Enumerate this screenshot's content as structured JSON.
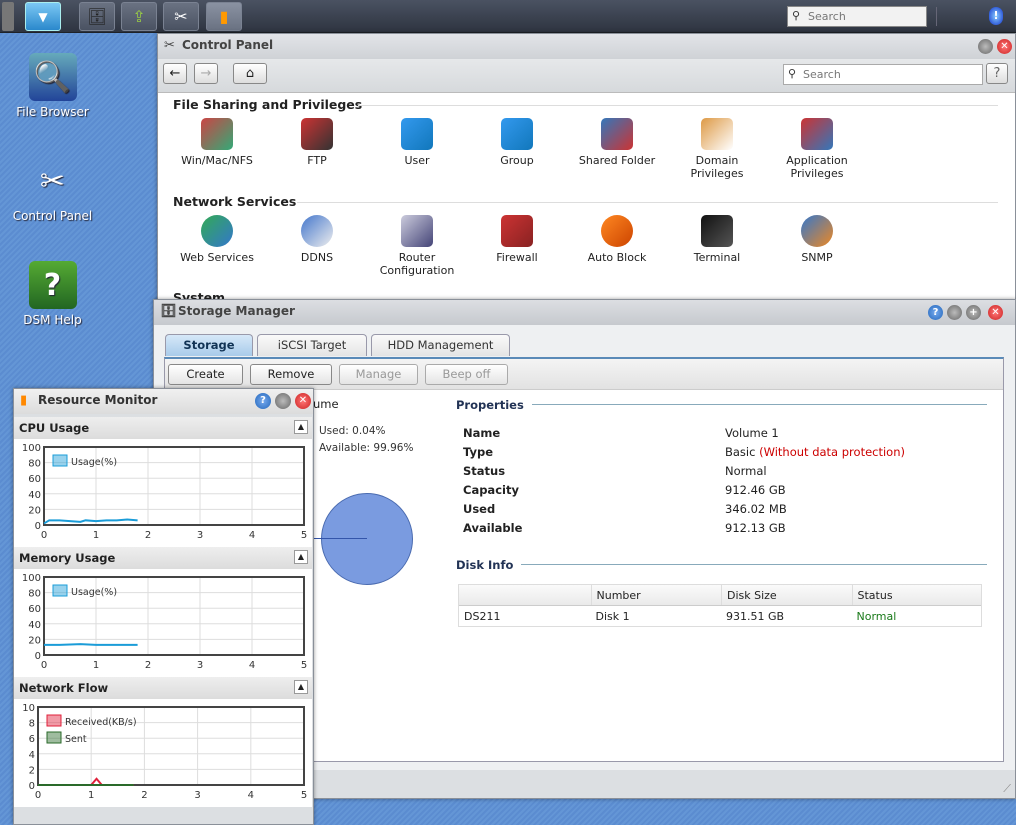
{
  "taskbar": {
    "search_placeholder": "Search",
    "apps": [
      "storage-manager",
      "download-station",
      "control-panel",
      "resource-monitor"
    ]
  },
  "desktop": {
    "icons": [
      {
        "label": "File Browser"
      },
      {
        "label": "Control Panel"
      },
      {
        "label": "DSM Help"
      }
    ]
  },
  "control_panel": {
    "title": "Control Panel",
    "search_placeholder": "Search",
    "help": "?",
    "sections": [
      {
        "title": "File Sharing and Privileges",
        "items": [
          "Win/Mac/NFS",
          "FTP",
          "User",
          "Group",
          "Shared Folder",
          "Domain Privileges",
          "Application Privileges"
        ]
      },
      {
        "title": "Network Services",
        "items": [
          "Web Services",
          "DDNS",
          "Router Configuration",
          "Firewall",
          "Auto Block",
          "Terminal",
          "SNMP"
        ]
      },
      {
        "title": "System",
        "items": []
      }
    ]
  },
  "storage_manager": {
    "title": "Storage Manager",
    "tabs": [
      "Storage",
      "iSCSI Target",
      "HDD Management"
    ],
    "active_tab": "Storage",
    "buttons": [
      {
        "label": "Create",
        "enabled": true
      },
      {
        "label": "Remove",
        "enabled": true
      },
      {
        "label": "Manage",
        "enabled": false
      },
      {
        "label": "Beep off",
        "enabled": false
      }
    ],
    "volume": {
      "label_partial": "ume",
      "used": "Used: 0.04%",
      "available": "Available: 99.96%",
      "used_pct": 0.04
    },
    "properties_title": "Properties",
    "properties": [
      {
        "k": "Name",
        "v": "Volume 1"
      },
      {
        "k": "Type",
        "v": "Basic",
        "note": "(Without data protection)"
      },
      {
        "k": "Status",
        "v": "Normal"
      },
      {
        "k": "Capacity",
        "v": "912.46 GB"
      },
      {
        "k": "Used",
        "v": "346.02 MB"
      },
      {
        "k": "Available",
        "v": "912.13 GB"
      }
    ],
    "disk_info_title": "Disk Info",
    "disk_columns": [
      "",
      "Number",
      "Disk Size",
      "Status"
    ],
    "disk_rows": [
      [
        "DS211",
        "Disk 1",
        "931.51 GB",
        "Normal"
      ]
    ],
    "colors": {
      "warning": "#cc0000",
      "ok": "#1a7a1a",
      "pie": "#7a9be0"
    }
  },
  "resource_monitor": {
    "title": "Resource Monitor",
    "sections": [
      "CPU Usage",
      "Memory Usage",
      "Network Flow"
    ]
  },
  "chart_data": [
    {
      "type": "line",
      "title": "CPU Usage",
      "xlim": [
        0,
        5
      ],
      "ylim": [
        0,
        100
      ],
      "xticks": [
        "0",
        "1",
        "2",
        "3",
        "4",
        "5"
      ],
      "yticks": [
        "0",
        "20",
        "40",
        "60",
        "80",
        "100"
      ],
      "grid": true,
      "legend": "top-left",
      "series": [
        {
          "name": "Usage(%)",
          "color": "#1a9cd8",
          "x": [
            0,
            0.1,
            0.3,
            0.5,
            0.7,
            0.8,
            1.0,
            1.2,
            1.4,
            1.6,
            1.8
          ],
          "y": [
            2,
            6,
            6,
            5,
            4,
            6,
            5,
            6,
            6,
            7,
            6
          ]
        }
      ]
    },
    {
      "type": "line",
      "title": "Memory Usage",
      "xlim": [
        0,
        5
      ],
      "ylim": [
        0,
        100
      ],
      "xticks": [
        "0",
        "1",
        "2",
        "3",
        "4",
        "5"
      ],
      "yticks": [
        "0",
        "20",
        "40",
        "60",
        "80",
        "100"
      ],
      "grid": true,
      "legend": "top-left",
      "series": [
        {
          "name": "Usage(%)",
          "color": "#1a9cd8",
          "x": [
            0,
            0.3,
            0.7,
            1.0,
            1.4,
            1.8
          ],
          "y": [
            13,
            13,
            14,
            13,
            13,
            13
          ]
        }
      ]
    },
    {
      "type": "line",
      "title": "Network Flow",
      "xlim": [
        0,
        5
      ],
      "ylim": [
        0,
        10
      ],
      "xticks": [
        "0",
        "1",
        "2",
        "3",
        "4",
        "5"
      ],
      "yticks": [
        "0",
        "2",
        "4",
        "6",
        "8",
        "10"
      ],
      "grid": true,
      "legend": "top-left",
      "series": [
        {
          "name": "Received(KB/s)",
          "color": "#e0203a",
          "x": [
            0,
            1.0,
            1.1,
            1.2,
            1.8
          ],
          "y": [
            0,
            0,
            0.8,
            0,
            0
          ]
        },
        {
          "name": "Sent",
          "color": "#2a6a2a",
          "x": [
            0,
            1.8
          ],
          "y": [
            0,
            0
          ]
        }
      ]
    }
  ]
}
